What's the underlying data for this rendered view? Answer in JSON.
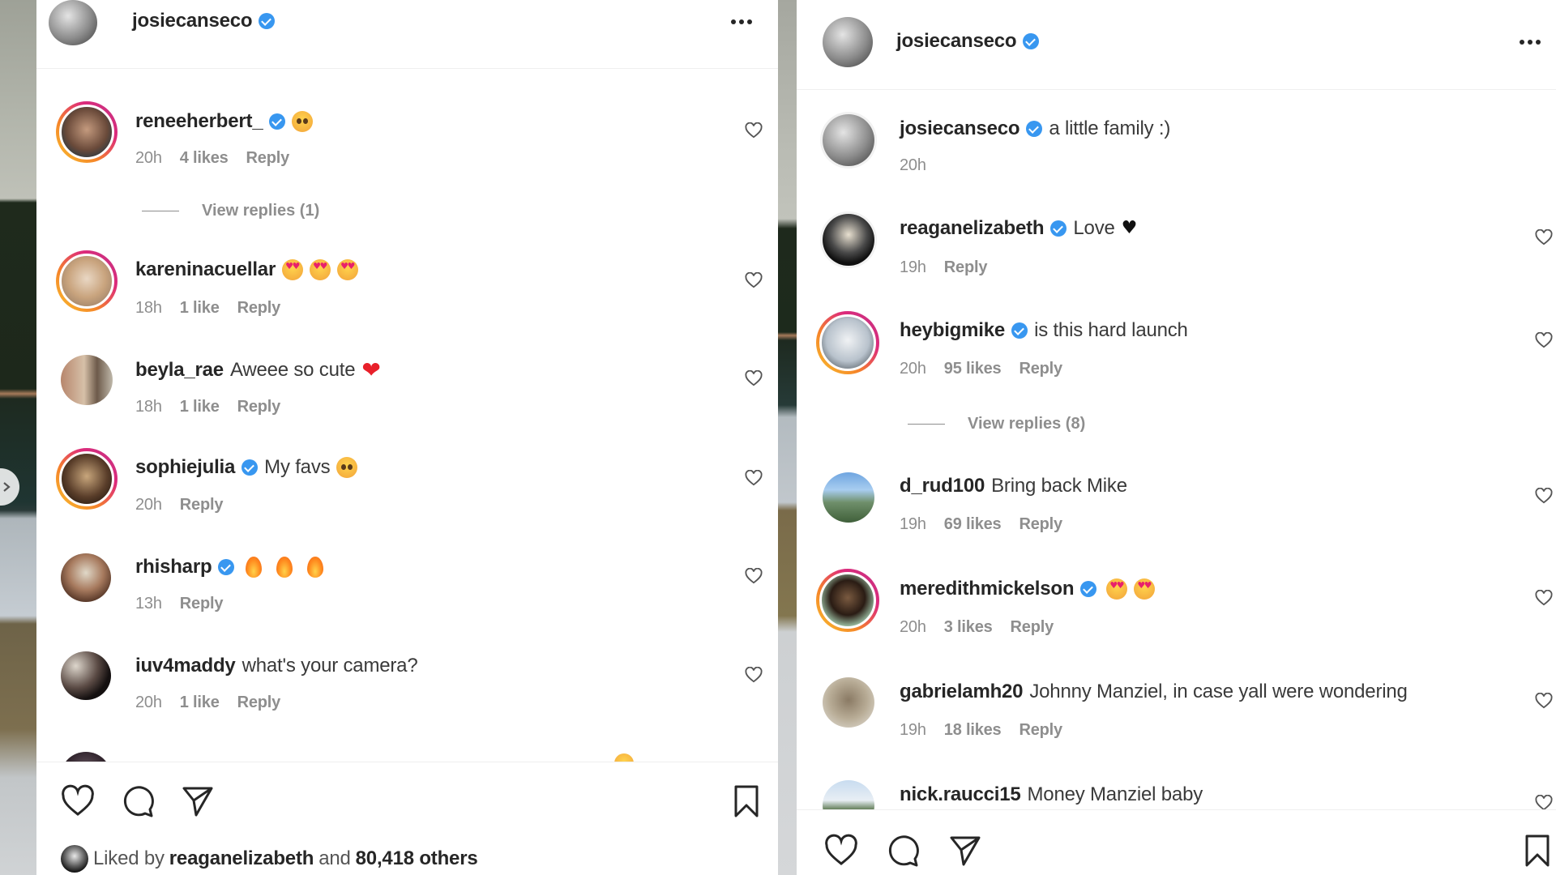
{
  "panels": {
    "left": {
      "header": {
        "username": "josiecanseco",
        "verified": true,
        "more_icon": "more-horizontal-icon"
      },
      "comments": [
        {
          "username": "reneeherbert_",
          "verified": true,
          "text": "",
          "emoji": [
            "pleading-face"
          ],
          "time": "20h",
          "likes": "4 likes",
          "reply": "Reply",
          "view_replies": "View replies (1)"
        },
        {
          "username": "kareninacuellar",
          "verified": false,
          "text": "",
          "emoji": [
            "heart-eyes",
            "heart-eyes",
            "heart-eyes"
          ],
          "time": "18h",
          "likes": "1 like",
          "reply": "Reply"
        },
        {
          "username": "beyla_rae",
          "verified": false,
          "text": "Aweee so cute",
          "emoji": [
            "red-heart"
          ],
          "time": "18h",
          "likes": "1 like",
          "reply": "Reply"
        },
        {
          "username": "sophiejulia",
          "verified": true,
          "text": "My favs",
          "emoji": [
            "pleading-face"
          ],
          "time": "20h",
          "likes": "",
          "reply": "Reply"
        },
        {
          "username": "rhisharp",
          "verified": true,
          "text": "",
          "emoji": [
            "fire",
            "fire",
            "fire"
          ],
          "time": "13h",
          "likes": "",
          "reply": "Reply"
        },
        {
          "username": "iuv4maddy",
          "verified": false,
          "text": "what's your camera?",
          "emoji": [],
          "time": "20h",
          "likes": "1 like",
          "reply": "Reply"
        }
      ],
      "actions": [
        "like-icon",
        "comment-icon",
        "share-icon",
        "bookmark-icon"
      ],
      "liked_by": {
        "prefix": "Liked by",
        "user": "reaganelizabeth",
        "joiner": "and",
        "others": "80,418 others"
      }
    },
    "right": {
      "header": {
        "username": "josiecanseco",
        "verified": true,
        "more_icon": "more-horizontal-icon"
      },
      "caption": {
        "username": "josiecanseco",
        "verified": true,
        "text": "a little family :)",
        "time": "20h"
      },
      "comments": [
        {
          "username": "reaganelizabeth",
          "verified": true,
          "text": "Love",
          "emoji": [
            "black-heart"
          ],
          "time": "19h",
          "likes": "",
          "reply": "Reply"
        },
        {
          "username": "heybigmike",
          "verified": true,
          "text": "is this hard launch",
          "emoji": [],
          "time": "20h",
          "likes": "95 likes",
          "reply": "Reply",
          "view_replies": "View replies (8)"
        },
        {
          "username": "d_rud100",
          "verified": false,
          "text": "Bring back Mike",
          "emoji": [],
          "time": "19h",
          "likes": "69 likes",
          "reply": "Reply"
        },
        {
          "username": "meredithmickelson",
          "verified": true,
          "text": "",
          "emoji": [
            "heart-eyes",
            "heart-eyes"
          ],
          "time": "20h",
          "likes": "3 likes",
          "reply": "Reply"
        },
        {
          "username": "gabrielamh20",
          "verified": false,
          "text": "Johnny Manziel, in case yall were wondering",
          "emoji": [],
          "time": "19h",
          "likes": "18 likes",
          "reply": "Reply"
        },
        {
          "username": "nick.raucci15",
          "verified": false,
          "text": "Money Manziel baby",
          "emoji": [],
          "time": "",
          "likes": "",
          "reply": ""
        }
      ],
      "actions": [
        "like-icon",
        "comment-icon",
        "share-icon",
        "bookmark-icon"
      ]
    }
  },
  "colors": {
    "verified": "#3897f0",
    "text_primary": "#262626",
    "text_secondary": "#8e8e8e",
    "story_ring": [
      "#f9c22e",
      "#f58529",
      "#dd2a7b",
      "#c13584"
    ]
  }
}
